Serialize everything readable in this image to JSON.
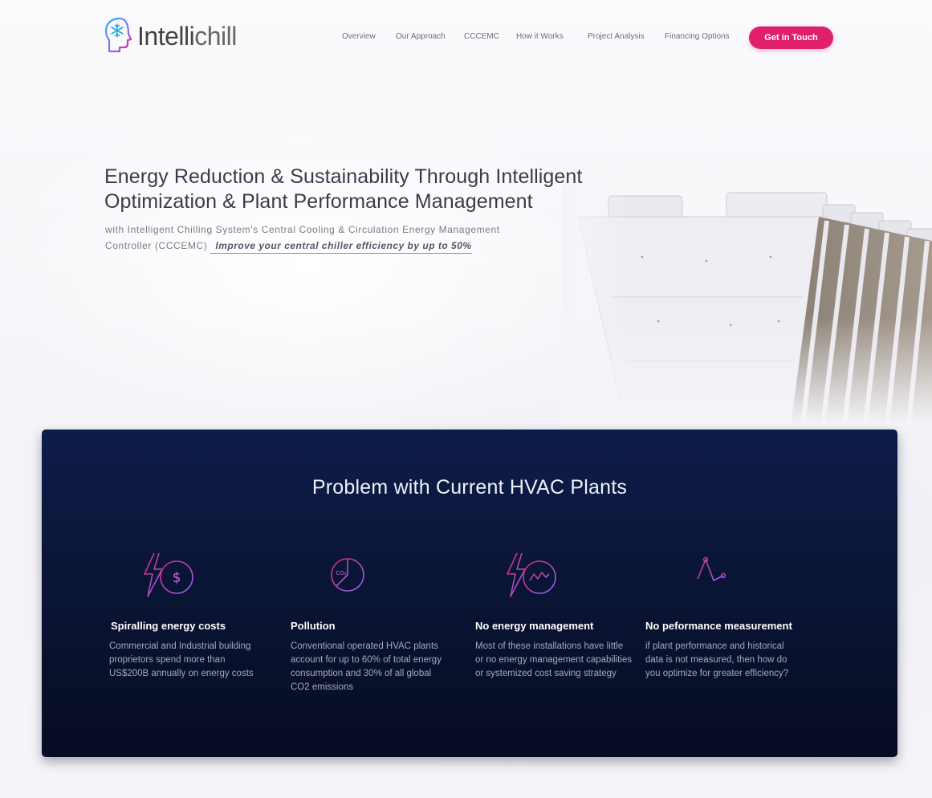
{
  "brand": {
    "name_main": "Intelli",
    "name_accent": "chill"
  },
  "nav": {
    "items": [
      "Overview",
      "Our Approach",
      "CCCEMC",
      "How it Works",
      "Project Analysis",
      "Financing Options"
    ],
    "cta": "Get in Touch"
  },
  "hero": {
    "title_line1": "Energy Reduction & Sustainability Through Intelligent",
    "title_line2": "Optimization & Plant Performance Management",
    "subtitle_line1": "with Intelligent Chilling System's Central Cooling & Circulation Energy Management",
    "subtitle_line2": "Controller (CCCEMC)",
    "highlight": "Improve your central chiller efficiency by up to 50%"
  },
  "problems": {
    "title": "Problem with Current HVAC Plants",
    "items": [
      {
        "icon": "lightning-dollar-icon",
        "heading": "Spiralling energy costs",
        "text": "Commercial and Industrial building proprietors spend more than US$200B annually on energy costs"
      },
      {
        "icon": "co2-pie-icon",
        "icon_label": "CO₂",
        "heading": "Pollution",
        "text": "Conventional operated HVAC plants account for up to 60% of total energy consumption and 30% of all global CO2 emissions"
      },
      {
        "icon": "lightning-wave-icon",
        "heading": "No energy management",
        "text": "Most of these installations have little or no energy management capabilities or systemized cost saving strategy"
      },
      {
        "icon": "line-graph-icon",
        "heading": "No peformance measurement",
        "text": "if plant performance and historical data is not measured, then how do you optimize for greater efficiency?"
      }
    ]
  },
  "colors": {
    "accent_pink": "#e0206a",
    "icon_gradient_start": "#e0206a",
    "icon_gradient_end": "#8a6cff",
    "panel_navy": "#0b1638"
  }
}
